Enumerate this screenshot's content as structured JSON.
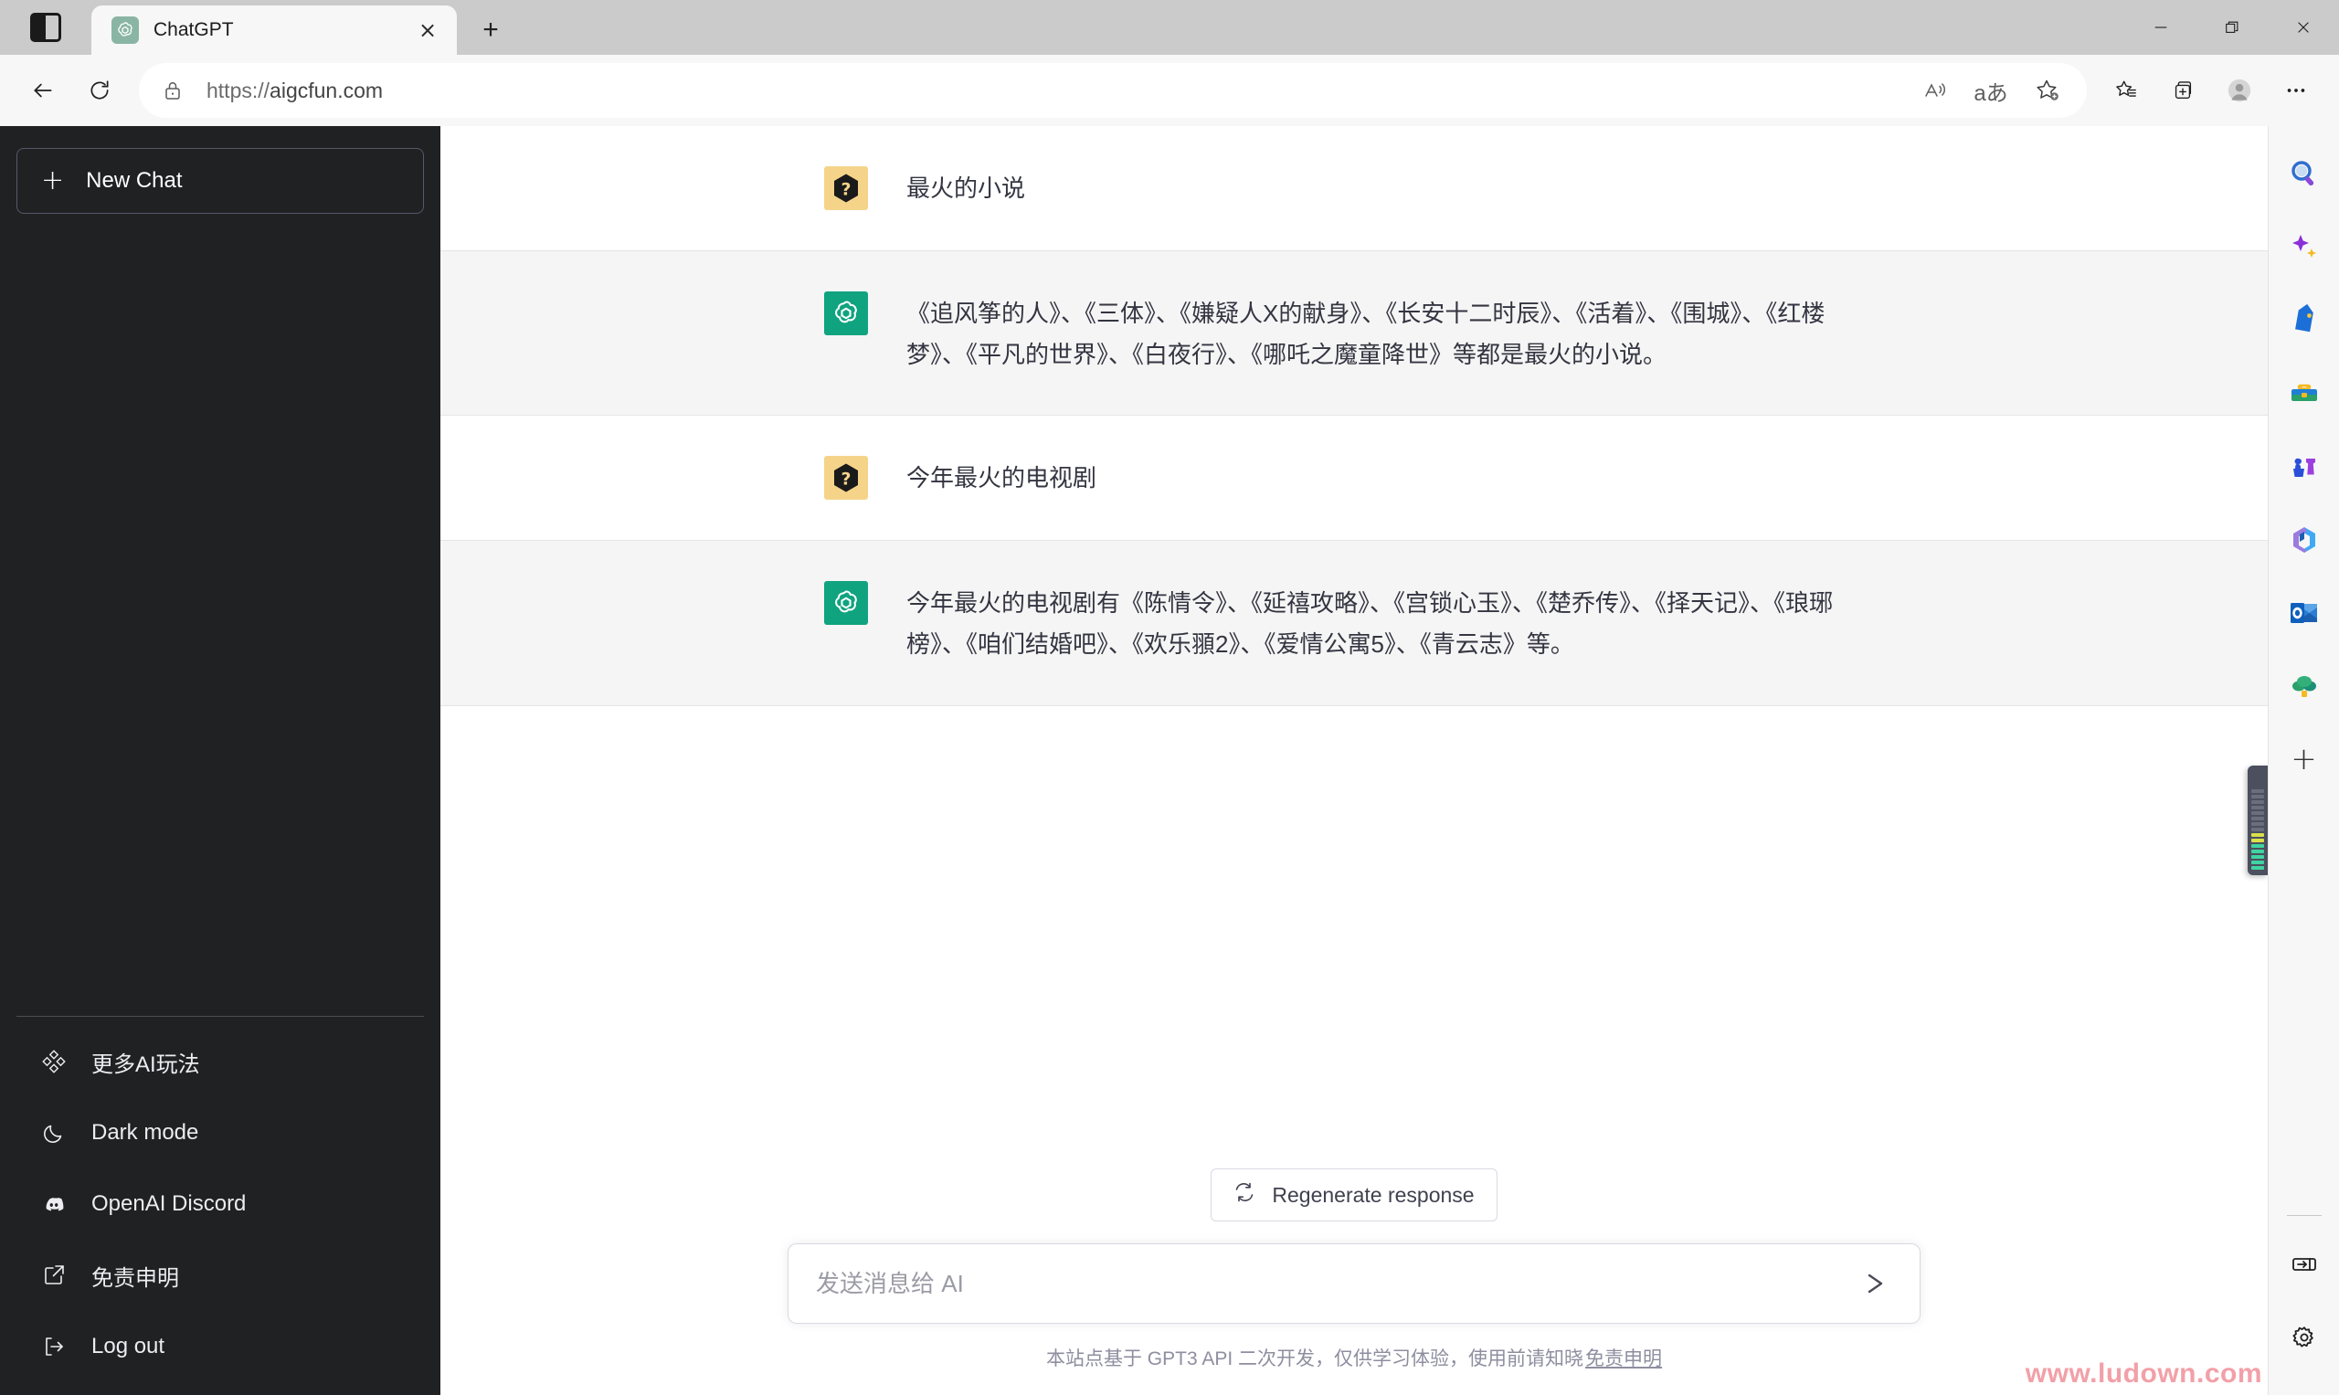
{
  "window": {
    "minimize_label": "Minimize",
    "restore_label": "Restore",
    "close_label": "Close"
  },
  "tabstrip": {
    "tab_search_label": "Tab actions",
    "tab_title": "ChatGPT",
    "tab_close_label": "×",
    "new_tab_label": "+"
  },
  "toolbar": {
    "back_label": "Back",
    "refresh_label": "Refresh",
    "url_scheme": "https://",
    "url_host": "aigcfun.com",
    "read_aloud_label": "Read aloud",
    "translate_label": "aあ",
    "add_favorite_label": "Add this page to favorites",
    "favorites_label": "Favorites",
    "collections_label": "Collections",
    "profile_label": "Profile",
    "settings_more_label": "Settings and more"
  },
  "sidebar": {
    "new_chat_label": "New Chat",
    "new_chat_plus": "+",
    "items": [
      {
        "label": "更多AI玩法",
        "icon": "sparkle-diamond-icon"
      },
      {
        "label": "Dark mode",
        "icon": "moon-icon"
      },
      {
        "label": "OpenAI Discord",
        "icon": "discord-icon"
      },
      {
        "label": "免责申明",
        "icon": "external-link-icon"
      },
      {
        "label": "Log out",
        "icon": "logout-icon"
      }
    ]
  },
  "conversation": {
    "messages": [
      {
        "role": "user",
        "avatar": "question-mark-avatar",
        "text": "最火的小说"
      },
      {
        "role": "assistant",
        "avatar": "openai-logo-avatar",
        "text": "《追风筝的人》、《三体》、《嫌疑人X的献身》、《长安十二时辰》、《活着》、《围城》、《红楼梦》、《平凡的世界》、《白夜行》、《哪吒之魔童降世》等都是最火的小说。"
      },
      {
        "role": "user",
        "avatar": "question-mark-avatar",
        "text": "今年最火的电视剧"
      },
      {
        "role": "assistant",
        "avatar": "openai-logo-avatar",
        "text": "今年最火的电视剧有《陈情令》、《延禧攻略》、《宫锁心玉》、《楚乔传》、《择天记》、《琅琊榜》、《咱们结婚吧》、《欢乐頨2》、《爱情公寓5》、《青云志》等。"
      }
    ]
  },
  "composer": {
    "regenerate_label": "Regenerate response",
    "input_value": "",
    "input_placeholder": "发送消息给 AI",
    "send_label": "Send",
    "footer_text": "本站点基于 GPT3 API 二次开发，仅供学习体验，使用前请知晓 ",
    "footer_link": "免责申明"
  },
  "edge_sidebar": {
    "items": [
      {
        "icon": "search-icon",
        "label": "Search"
      },
      {
        "icon": "copilot-sparkle-icon",
        "label": "Copilot"
      },
      {
        "icon": "shopping-tag-icon",
        "label": "Shopping"
      },
      {
        "icon": "toolbox-icon",
        "label": "Tools"
      },
      {
        "icon": "games-chess-icon",
        "label": "Games"
      },
      {
        "icon": "microsoft-365-icon",
        "label": "Microsoft 365"
      },
      {
        "icon": "outlook-icon",
        "label": "Outlook"
      },
      {
        "icon": "drop-tree-icon",
        "label": "Drop"
      }
    ],
    "add_label": "+",
    "expand_label": "Expand sidebar",
    "settings_label": "Sidebar settings"
  },
  "overlay": {
    "meter_label": "volume-meter-widget",
    "watermark": "www.ludown.com"
  },
  "colors": {
    "accent_green": "#10a37f",
    "user_avatar": "#f5d48a",
    "assistant_row_bg": "#f5f5f5",
    "sidebar_bg": "#202123",
    "watermark_pink": "#f2a0a8"
  }
}
